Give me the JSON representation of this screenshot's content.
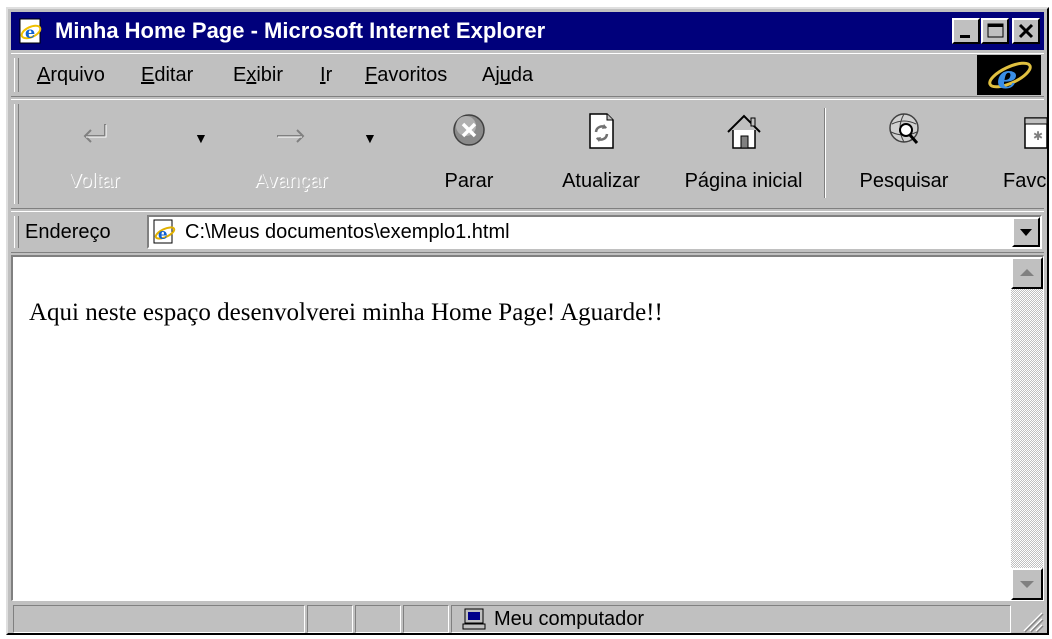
{
  "window": {
    "title": "Minha Home Page - Microsoft Internet Explorer"
  },
  "menubar": {
    "items": [
      {
        "label": "Arquivo",
        "hotkey": "A",
        "rest": "rquivo",
        "pre": ""
      },
      {
        "label": "Editar",
        "hotkey": "E",
        "rest": "ditar",
        "pre": ""
      },
      {
        "label": "Exibir",
        "hotkey": "x",
        "rest": "ibir",
        "pre": "E"
      },
      {
        "label": "Ir",
        "hotkey": "I",
        "rest": "r",
        "pre": ""
      },
      {
        "label": "Favoritos",
        "hotkey": "F",
        "rest": "avoritos",
        "pre": ""
      },
      {
        "label": "Ajuda",
        "hotkey": "u",
        "rest": "da",
        "pre": "Aj"
      }
    ]
  },
  "toolbar": {
    "back_label": "Voltar",
    "forward_label": "Avançar",
    "stop_label": "Parar",
    "refresh_label": "Atualizar",
    "home_label": "Página inicial",
    "search_label": "Pesquisar",
    "favorites_label": "Favc"
  },
  "address": {
    "label": "Endereço",
    "value": "C:\\Meus documentos\\exemplo1.html"
  },
  "page": {
    "text": "Aqui neste espaço desenvolverei minha Home Page! Aguarde!!"
  },
  "status": {
    "zone": "Meu computador"
  },
  "colors": {
    "titlebar": "#00007b",
    "chrome": "#c0c0c0"
  }
}
